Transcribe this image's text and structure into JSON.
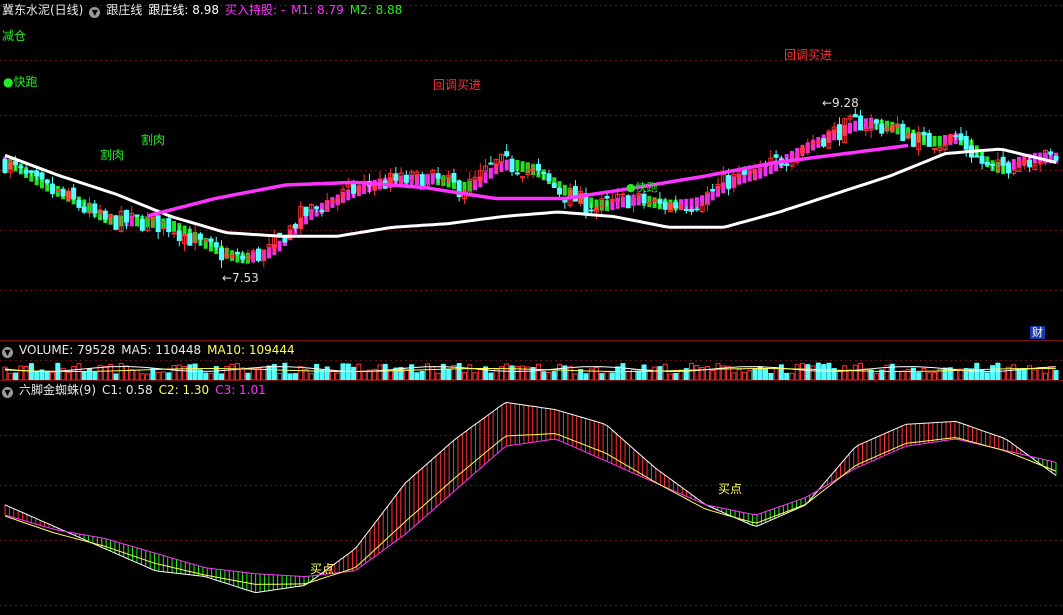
{
  "colors": {
    "up": "#ff3232",
    "down": "#54ffff",
    "pink": "#ff33ff",
    "green": "#22ee22",
    "white": "#ffffff",
    "yellow": "#ffff55",
    "grid": "#6a1010"
  },
  "main": {
    "stock_name": "冀东水泥(日线)",
    "indicator": "跟庄线",
    "line_label": "跟庄线: 8.98",
    "buy_label": "买入持股: -",
    "m1_label": "M1: 8.79",
    "m2_label": "M2: 8.88",
    "signal_reduce": "减仓",
    "signal_fast_exit": "●快跑",
    "signal_cut_loss_1": "割肉",
    "signal_cut_loss_2": "割肉",
    "signal_pullback_1": "回调买进",
    "signal_pullback_2": "回调买进",
    "signal_fast_exit_2": "●快跑",
    "low_price": "←7.53",
    "high_price": "←9.28",
    "finance_badge": "财"
  },
  "volume": {
    "label": "VOLUME: 79528",
    "ma5_label": "MA5: 110448",
    "ma10_label": "MA10: 109444"
  },
  "spider": {
    "name": "六脚金蜘蛛(9)",
    "c1_label": "C1: 0.58",
    "c2_label": "C2: 1.30",
    "c3_label": "C3: 1.01",
    "buy_point_1": "买点",
    "buy_point_2": "买点"
  },
  "chart_data": {
    "type": "candlestick",
    "price_low": 7.53,
    "price_high": 9.28,
    "close_anchors": [
      8.7,
      8.45,
      8.28,
      8.05,
      8.05,
      8.0,
      7.78,
      7.62,
      7.7,
      8.1,
      8.3,
      8.45,
      8.5,
      8.52,
      8.4,
      8.7,
      8.62,
      8.35,
      8.2,
      8.3,
      8.22,
      8.25,
      8.5,
      8.6,
      8.82,
      9.0,
      9.15,
      9.08,
      8.92,
      8.98,
      8.6,
      8.75,
      8.75
    ],
    "follow_line": [
      8.78,
      8.55,
      8.35,
      8.1,
      7.92,
      7.88,
      7.88,
      7.98,
      8.02,
      8.1,
      8.15,
      8.1,
      7.98,
      7.98,
      8.15,
      8.35,
      8.55,
      8.8,
      8.85,
      8.7
    ],
    "m1_line": [
      7.9,
      8.0,
      8.1,
      8.3,
      8.45,
      8.48,
      8.42,
      8.3,
      8.3,
      8.42,
      8.55,
      8.7,
      8.8,
      8.9,
      8.9,
      8.85
    ],
    "volume": {
      "current": 79528,
      "ma5": 110448,
      "ma10": 109444
    },
    "spider": {
      "c1": 0.58,
      "c2": 1.3,
      "c3": 1.01,
      "fast_curve": [
        0.75,
        0.6,
        0.45,
        0.3,
        0.26,
        0.15,
        0.2,
        0.45,
        0.9,
        1.2,
        1.45,
        1.4,
        1.3,
        1.0,
        0.75,
        0.6,
        0.75,
        1.15,
        1.3,
        1.32,
        1.2,
        0.95
      ],
      "slow_curve": [
        0.68,
        0.58,
        0.52,
        0.42,
        0.32,
        0.28,
        0.26,
        0.3,
        0.55,
        0.85,
        1.15,
        1.2,
        1.05,
        0.9,
        0.75,
        0.68,
        0.8,
        1.0,
        1.15,
        1.2,
        1.12,
        1.04
      ]
    }
  }
}
